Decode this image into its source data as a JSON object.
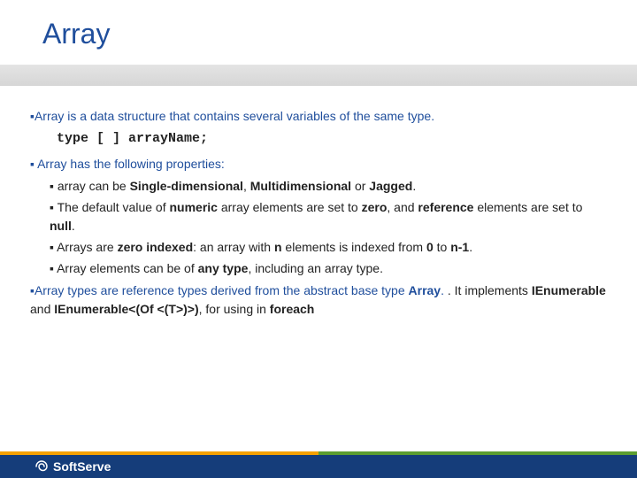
{
  "title": "Array",
  "b1": {
    "text": "Array is a data structure that contains several variables of the same type.",
    "code": "type [ ]   arrayName;"
  },
  "b2": {
    "lead": "Array has the following properties:",
    "items": [
      {
        "pre": "array can be ",
        "b1": "Single-dimensional",
        "mid1": ", ",
        "b2": "Multidimensional",
        "mid2": " or ",
        "b3": "Jagged",
        "post": "."
      },
      {
        "pre": "The default value of ",
        "b1": "numeric",
        "mid1": " array elements are set to ",
        "b2": "zero",
        "mid2": ", and ",
        "b3": "reference",
        "mid3": " elements are set to ",
        "b4": "null",
        "post": "."
      },
      {
        "pre": "Arrays are ",
        "b1": "zero indexed",
        "mid1": ": an array with ",
        "b2": "n",
        "mid2": " elements is indexed from ",
        "b3": "0",
        "mid3": " to ",
        "b4": "n-1",
        "post": "."
      },
      {
        "pre": "Array elements can be of ",
        "b1": "any type",
        "post": ", including an array type."
      }
    ]
  },
  "b3": {
    "lead1": "Array types are reference types derived from the abstract base type ",
    "lead_b": "Array",
    "lead2": ". It implements ",
    "b1": "IEnumerable",
    "mid": " and ",
    "b2": "IEnumerable<(Of <(T>)>)",
    "post": ", for using in ",
    "b3": "foreach"
  },
  "footer": {
    "brand": "SoftServe"
  }
}
